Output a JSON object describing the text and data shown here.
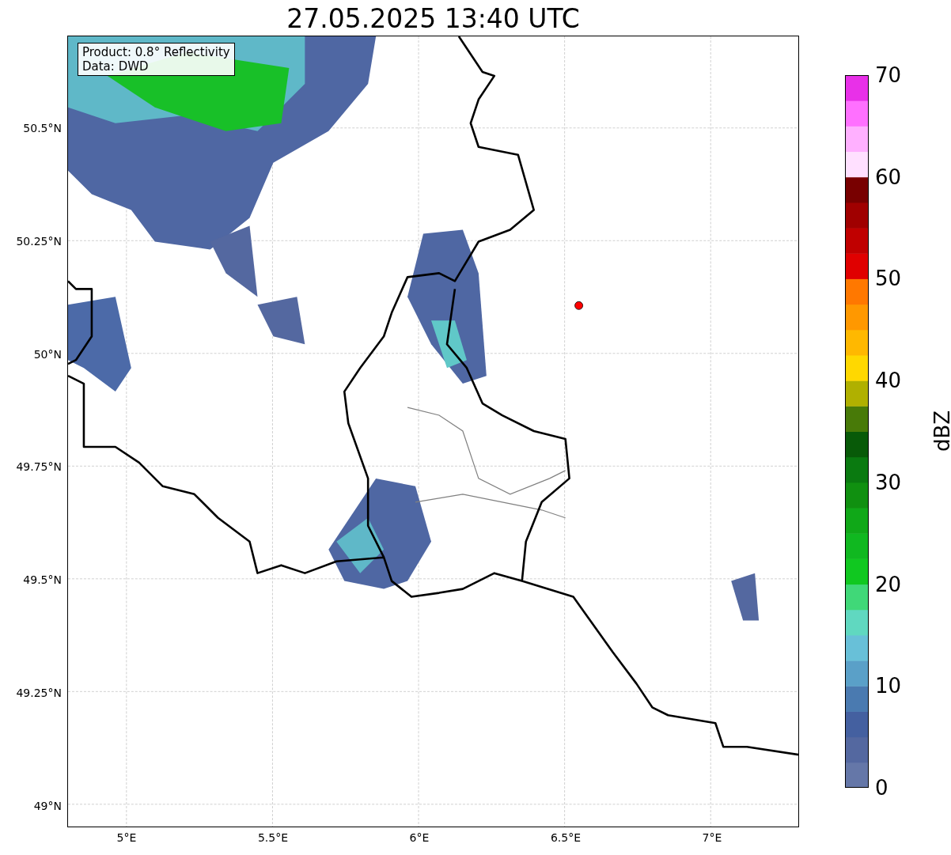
{
  "title": "27.05.2025 13:40 UTC",
  "annotation": {
    "lines": [
      "Product: 0.8° Reflectivity",
      "Data: DWD"
    ]
  },
  "axes": {
    "yticks": [
      "50.5°N",
      "50.25°N",
      "50°N",
      "49.75°N",
      "49.5°N",
      "49.25°N",
      "49°N"
    ],
    "xticks": [
      "5°E",
      "5.5°E",
      "6°E",
      "6.5°E",
      "7°E"
    ]
  },
  "colorbar": {
    "label": "dBZ",
    "ticks": [
      "70",
      "60",
      "50",
      "40",
      "30",
      "20",
      "10",
      "0"
    ]
  }
}
